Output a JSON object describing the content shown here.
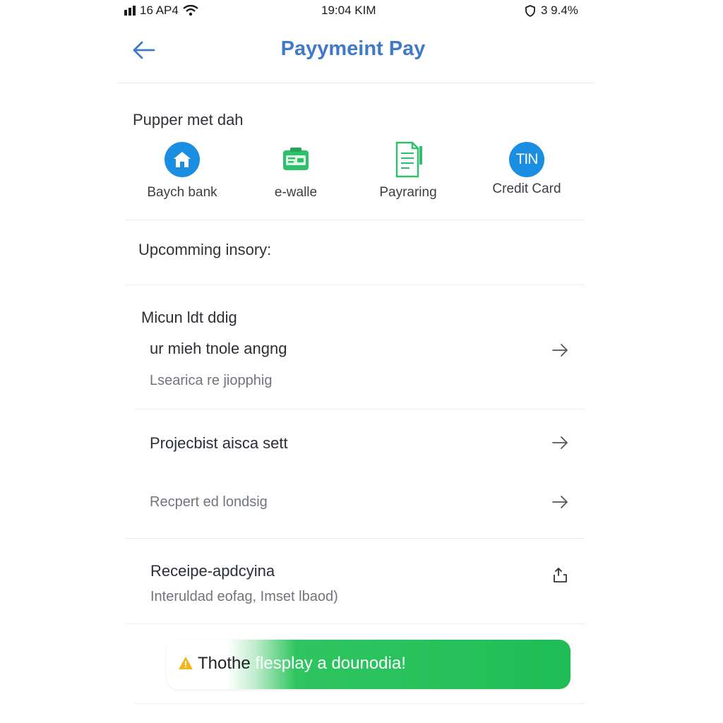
{
  "status_bar": {
    "carrier": "16 AP4",
    "time": "19:04 KIM",
    "battery": "3 9.4%"
  },
  "header": {
    "title": "Payymeint Pay"
  },
  "payment_section": {
    "label": "Pupper met dah",
    "methods": [
      {
        "label": "Baych bank",
        "icon": "bank-icon"
      },
      {
        "label": "e-walle",
        "icon": "wallet-icon"
      },
      {
        "label": "Payraring",
        "icon": "document-icon"
      },
      {
        "label": "Credit Card",
        "icon": "card-icon",
        "icon_text": "TIN"
      }
    ]
  },
  "upcoming": {
    "label": "Upcomming insory:"
  },
  "list": {
    "group_heading": "Micun ldt ddig",
    "items": [
      {
        "title": "ur mieh tnole angng",
        "subtitle": "Lsearica re jiopphig"
      },
      {
        "title": "Projecbist aisca sett"
      },
      {
        "title": "Recpert ed londsig"
      },
      {
        "title": "Receipe-apdcyina",
        "subtitle": "Interuldad eofag, Imset lbaod)"
      }
    ]
  },
  "banner": {
    "prefix": "Thothe",
    "rest": " flesplay a dounodia!"
  },
  "colors": {
    "accent_blue": "#3f79c9",
    "icon_blue": "#1a8ee0",
    "green": "#1fbd55"
  }
}
